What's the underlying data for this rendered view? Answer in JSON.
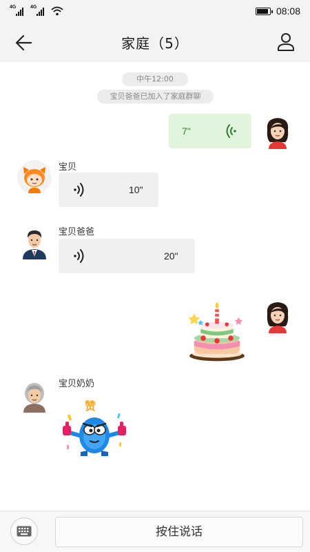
{
  "status_bar": {
    "signal1_tag": "4G",
    "signal2_tag": "4G",
    "time": "08:08",
    "battery_level": 0.9
  },
  "header": {
    "title": "家庭（5）",
    "back_icon": "arrow-left-icon",
    "profile_icon": "person-icon"
  },
  "chat": {
    "time_label": "中午12:00",
    "system_message": "宝贝爸爸已加入了家庭群聊",
    "messages": [
      {
        "from": "me",
        "type": "voice",
        "duration": "7\""
      },
      {
        "from": "宝贝",
        "type": "voice",
        "duration": "10\""
      },
      {
        "from": "宝贝爸爸",
        "type": "voice",
        "duration": "20\""
      },
      {
        "from": "me",
        "type": "sticker",
        "sticker": "cake-sticker"
      },
      {
        "from": "宝贝奶奶",
        "type": "sticker",
        "sticker": "thumbs-up-monster-sticker",
        "sticker_text": "赞"
      }
    ]
  },
  "bottom_bar": {
    "keyboard_icon": "keyboard-icon",
    "hold_to_talk": "按住说话"
  },
  "colors": {
    "my_bubble": "#e1f5dc",
    "other_bubble": "#f0f0f0",
    "voice_green": "#2e7d32"
  }
}
